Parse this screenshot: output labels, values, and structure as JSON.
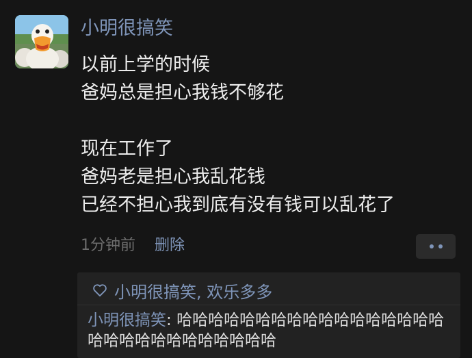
{
  "post": {
    "author": "小明很搞笑",
    "avatar_icon": "duck-avatar-icon",
    "lines": [
      "以前上学的时候",
      "爸妈总是担心我钱不够花",
      "",
      "现在工作了",
      "爸妈老是担心我乱花钱",
      "已经不担心我到底有没有钱可以乱花了"
    ],
    "time": "1分钟前",
    "delete_label": "删除",
    "more_icon": "more-dots-icon"
  },
  "interactions": {
    "like_icon": "heart-outline-icon",
    "likes_text": "小明很搞笑, 欢乐多多",
    "comment": {
      "author": "小明很搞笑",
      "separator": ": ",
      "text": "哈哈哈哈哈哈哈哈哈哈哈哈哈哈哈哈哈哈哈哈哈哈哈哈哈哈哈哈哈"
    }
  },
  "colors": {
    "background": "#151515",
    "link_blue": "#7f95b9",
    "text": "#ededed",
    "muted": "#6d6d6d",
    "panel": "#222222"
  }
}
